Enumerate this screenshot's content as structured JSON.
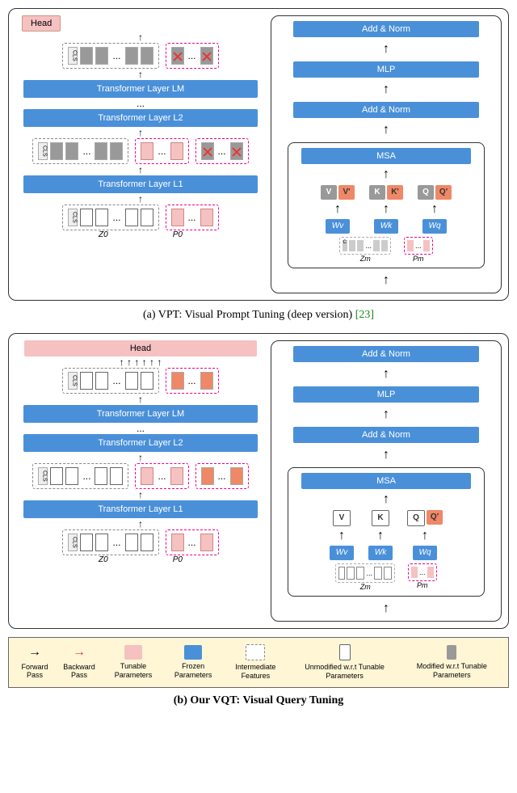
{
  "panel_a": {
    "head": "Head",
    "layer_m": "Transformer Layer LM",
    "layer_2": "Transformer Layer L2",
    "layer_1": "Transformer Layer L1",
    "dots": "...",
    "z0": "Z0",
    "p0": "P0",
    "caption_prefix": "(a) VPT: Visual Prompt Tuning (deep version)",
    "caption_ref": "[23]"
  },
  "panel_b": {
    "head": "Head",
    "layer_m": "Transformer Layer LM",
    "layer_2": "Transformer Layer L2",
    "layer_1": "Transformer Layer L1",
    "dots": "...",
    "z0": "Z0",
    "p0": "P0",
    "caption": "(b) Our VQT: Visual Query Tuning"
  },
  "detail": {
    "add_norm": "Add & Norm",
    "mlp": "MLP",
    "msa": "MSA",
    "v": "V",
    "v2": "V'",
    "k": "K",
    "k2": "K'",
    "q": "Q",
    "q2": "Q'",
    "wv": "Wv",
    "wk": "Wk",
    "wq": "Wq",
    "zm": "Zm",
    "pm": "Pm"
  },
  "legend": {
    "forward": "Forward\nPass",
    "backward": "Backward\nPass",
    "tunable": "Tunable\nParameters",
    "frozen": "Frozen\nParameters",
    "interm": "Intermediate\nFeatures",
    "unmod": "Unmodified w.r.t\nTunable Parameters",
    "mod": "Modified w.r.t\nTunable Parameters"
  }
}
